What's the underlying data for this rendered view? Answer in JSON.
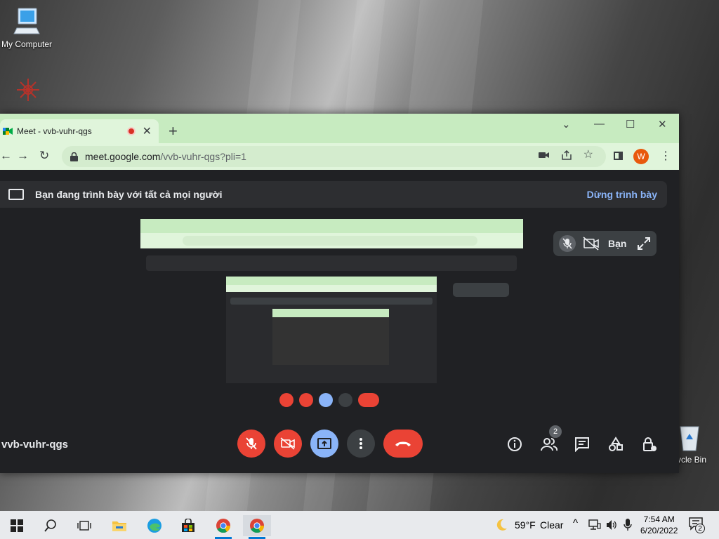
{
  "desktop": {
    "icons": [
      {
        "label": "My Computer",
        "icon": "monitor-icon"
      },
      {
        "label": "cycle Bin",
        "icon": "recycle-bin-icon"
      }
    ]
  },
  "browser": {
    "tab_title": "Meet - vvb-vuhr-qgs",
    "new_tab": "+",
    "url_host": "meet.google.com",
    "url_path": "/vvb-vuhr-qgs?pli=1",
    "profile_initial": "W"
  },
  "meet": {
    "banner_text": "Bạn đang trình bày với tất cả mọi người",
    "stop_presenting": "Dừng trình bày",
    "self_tile_label": "Bạn",
    "meeting_code": "vvb-vuhr-qgs",
    "participants_count": "2",
    "colors": {
      "danger": "#ea4335",
      "accent": "#8ab4f8",
      "surface": "#3c4043"
    }
  },
  "taskbar": {
    "weather_temp": "59°F",
    "weather_desc": "Clear",
    "time": "7:54 AM",
    "date": "6/20/2022",
    "notification_count": "2"
  }
}
